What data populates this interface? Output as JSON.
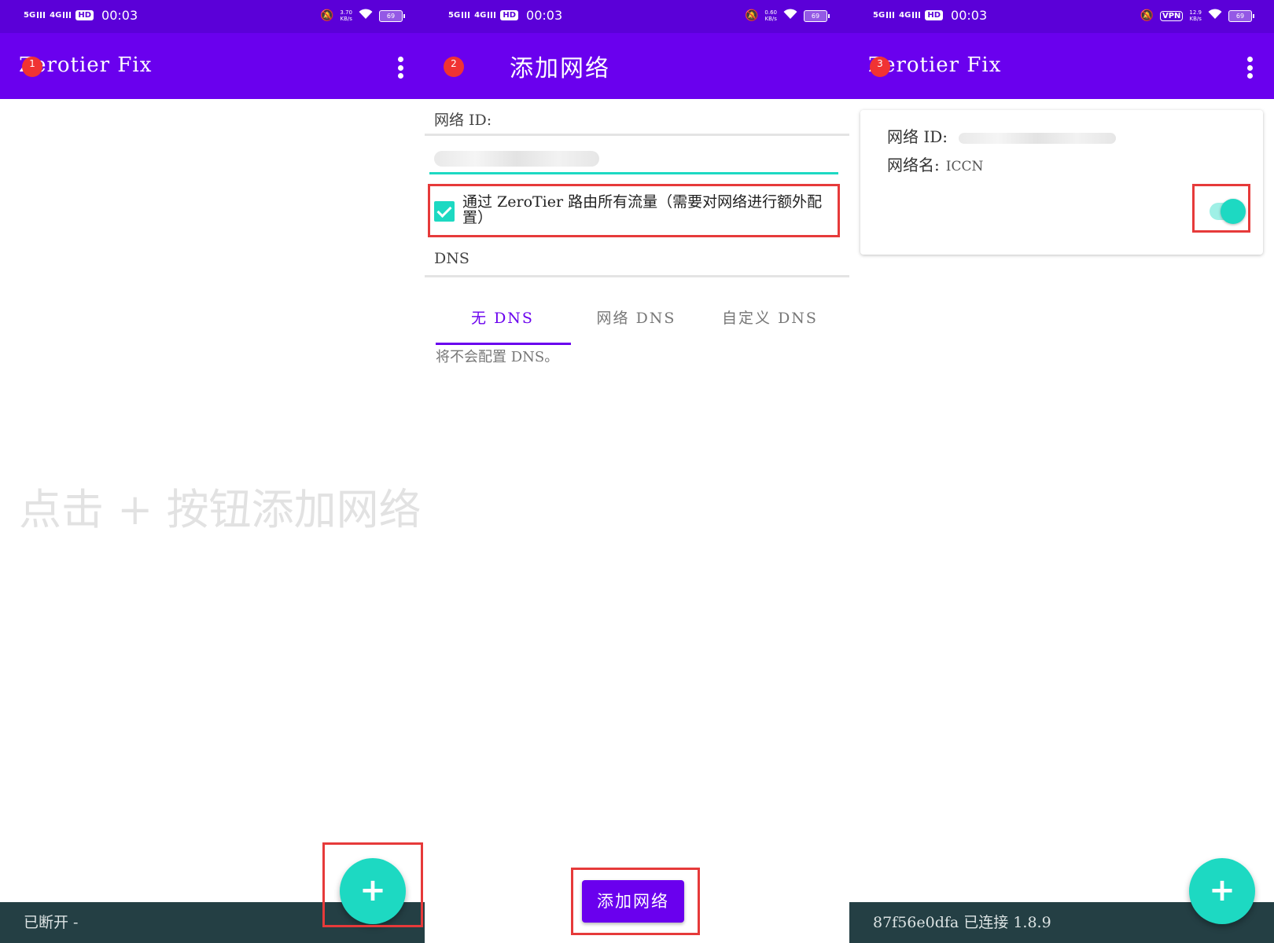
{
  "colors": {
    "status_bar": "#5b00d8",
    "app_bar": "#6a00ee",
    "accent": "#1dd9c2",
    "status_strip": "#243f44",
    "highlight_box": "#e63a3a",
    "step_marker": "#f03333"
  },
  "screens": [
    {
      "step": "1",
      "status_bar": {
        "network_1": "5G",
        "network_2": "4G",
        "hd": "HD",
        "time": "00:03",
        "speed": "3.70\nKB/s",
        "battery": "69"
      },
      "app_title": "Zerotier Fix",
      "menu_icon": "more-vert-icon",
      "empty_hint": "点击 + 按钮添加网络",
      "fab_label": "+",
      "fab_icon": "plus-icon",
      "footer_status": "已断开  -"
    },
    {
      "step": "2",
      "status_bar": {
        "network_1": "5G",
        "network_2": "4G",
        "hd": "HD",
        "time": "00:03",
        "speed": "0.60\nKB/s",
        "battery": "69"
      },
      "back_icon": "back-arrow-icon",
      "title": "添加网络",
      "network_id_label": "网络 ID:",
      "route_all_label": "通过 ZeroTier 路由所有流量（需要对网络进行额外配置）",
      "route_all_checked": true,
      "dns_label": "DNS",
      "dns_tabs": [
        "无 DNS",
        "网络 DNS",
        "自定义 DNS"
      ],
      "dns_selected": "无 DNS",
      "dns_desc": "将不会配置 DNS。",
      "add_button": "添加网络"
    },
    {
      "step": "3",
      "status_bar": {
        "network_1": "5G",
        "network_2": "4G",
        "hd": "HD",
        "time": "00:03",
        "vpn": "VPN",
        "speed": "12.9\nKB/s",
        "battery": "69"
      },
      "app_title": "Zerotier Fix",
      "menu_icon": "more-vert-icon",
      "network_id_label": "网络 ID:",
      "network_name_label": "网络名:",
      "network_name": "ICCN",
      "enabled": true,
      "fab_label": "+",
      "fab_icon": "plus-icon",
      "footer_status": "87f56e0dfa  已连接  1.8.9"
    }
  ]
}
